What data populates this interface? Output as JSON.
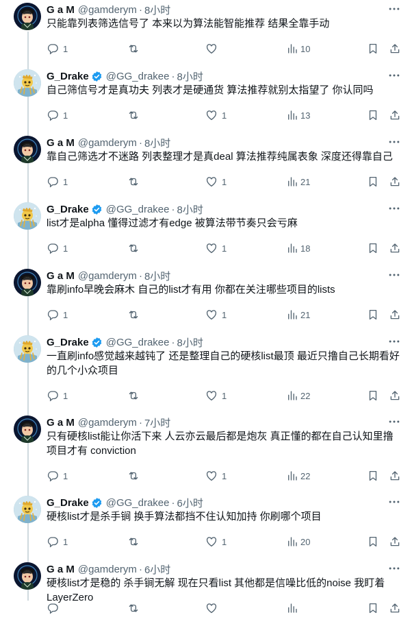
{
  "tweets": [
    {
      "author": "gam",
      "name": "G a M",
      "handle": "@gamderym",
      "time": "8小时",
      "verified": false,
      "text": "只能靠列表筛选信号了 本来以为算法能智能推荐 结果全靠手动",
      "replies": "1",
      "retweets": "",
      "likes": "",
      "views": "10"
    },
    {
      "author": "drake",
      "name": "G_Drake",
      "handle": "@GG_drakee",
      "time": "8小时",
      "verified": true,
      "text": "自己筛信号才是真功夫 列表才是硬通货 算法推荐就别太指望了 你认同吗",
      "replies": "1",
      "retweets": "",
      "likes": "1",
      "views": "13"
    },
    {
      "author": "gam",
      "name": "G a M",
      "handle": "@gamderym",
      "time": "8小时",
      "verified": false,
      "text": "靠自己筛选才不迷路 列表整理才是真deal 算法推荐纯属表象 深度还得靠自己",
      "replies": "1",
      "retweets": "",
      "likes": "1",
      "views": "21"
    },
    {
      "author": "drake",
      "name": "G_Drake",
      "handle": "@GG_drakee",
      "time": "8小时",
      "verified": true,
      "text": "list才是alpha 懂得过滤才有edge 被算法带节奏只会亏麻",
      "replies": "1",
      "retweets": "",
      "likes": "1",
      "views": "18"
    },
    {
      "author": "gam",
      "name": "G a M",
      "handle": "@gamderym",
      "time": "8小时",
      "verified": false,
      "text": "靠刷info早晚会麻木 自己的list才有用 你都在关注哪些项目的lists",
      "replies": "1",
      "retweets": "",
      "likes": "1",
      "views": "21"
    },
    {
      "author": "drake",
      "name": "G_Drake",
      "handle": "@GG_drakee",
      "time": "8小时",
      "verified": true,
      "text": "一直刷info感觉越来越钝了 还是整理自己的硬核list最顶 最近只撸自己长期看好的几个小众项目",
      "replies": "1",
      "retweets": "",
      "likes": "1",
      "views": "22"
    },
    {
      "author": "gam",
      "name": "G a M",
      "handle": "@gamderym",
      "time": "7小时",
      "verified": false,
      "text": "只有硬核list能让你活下来 人云亦云最后都是炮灰 真正懂的都在自己认知里撸项目才有 conviction",
      "replies": "1",
      "retweets": "",
      "likes": "1",
      "views": "22"
    },
    {
      "author": "drake",
      "name": "G_Drake",
      "handle": "@GG_drakee",
      "time": "6小时",
      "verified": true,
      "text": "硬核list才是杀手锏 换手算法都挡不住认知加持 你刷哪个项目",
      "replies": "1",
      "retweets": "",
      "likes": "1",
      "views": "20"
    },
    {
      "author": "gam",
      "name": "G a M",
      "handle": "@gamderym",
      "time": "6小时",
      "verified": false,
      "text": "硬核list才是稳的 杀手锏无解 现在只看list 其他都是信噪比低的noise 我盯着LayerZero",
      "replies": "",
      "retweets": "",
      "likes": "",
      "views": ""
    }
  ],
  "colors": {
    "verified": "#1d9bf0",
    "secondary": "#536471",
    "line": "#cfd9de"
  }
}
